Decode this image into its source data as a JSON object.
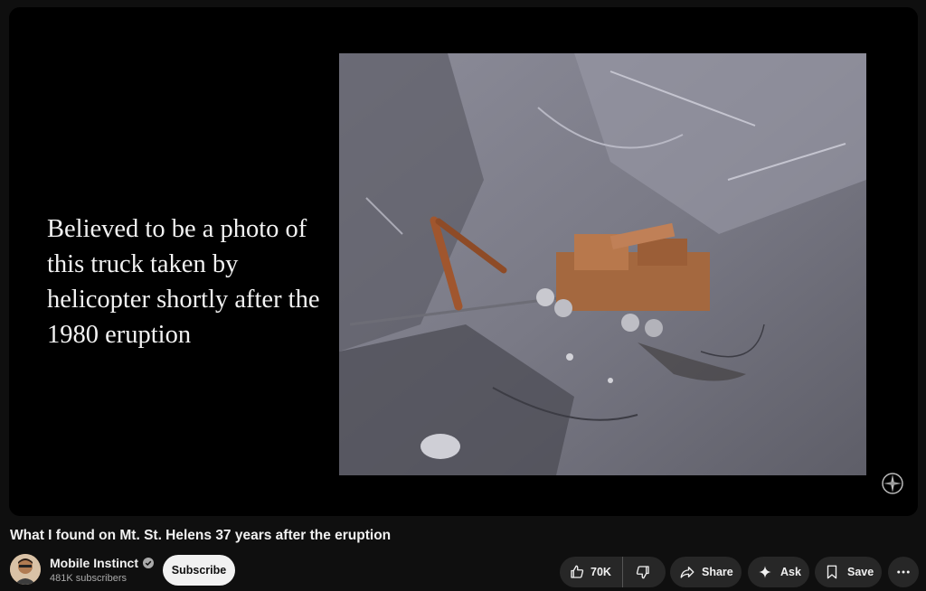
{
  "video": {
    "caption": "Believed to be a photo of this truck taken by helicopter shortly after the 1980 eruption",
    "title": "What I found on Mt. St. Helens 37 years after the eruption"
  },
  "channel": {
    "name": "Mobile Instinct",
    "subscribers": "481K subscribers",
    "subscribe_label": "Subscribe"
  },
  "actions": {
    "like_count": "70K",
    "share_label": "Share",
    "ask_label": "Ask",
    "save_label": "Save"
  },
  "icons": [
    "thumbs-up-icon",
    "thumbs-down-icon",
    "share-icon",
    "sparkle-icon",
    "save-icon",
    "more-icon",
    "verified-icon"
  ],
  "colors": {
    "background": "#0f0f0f",
    "pill": "#272727",
    "subscribe_bg": "#f1f1f1"
  }
}
